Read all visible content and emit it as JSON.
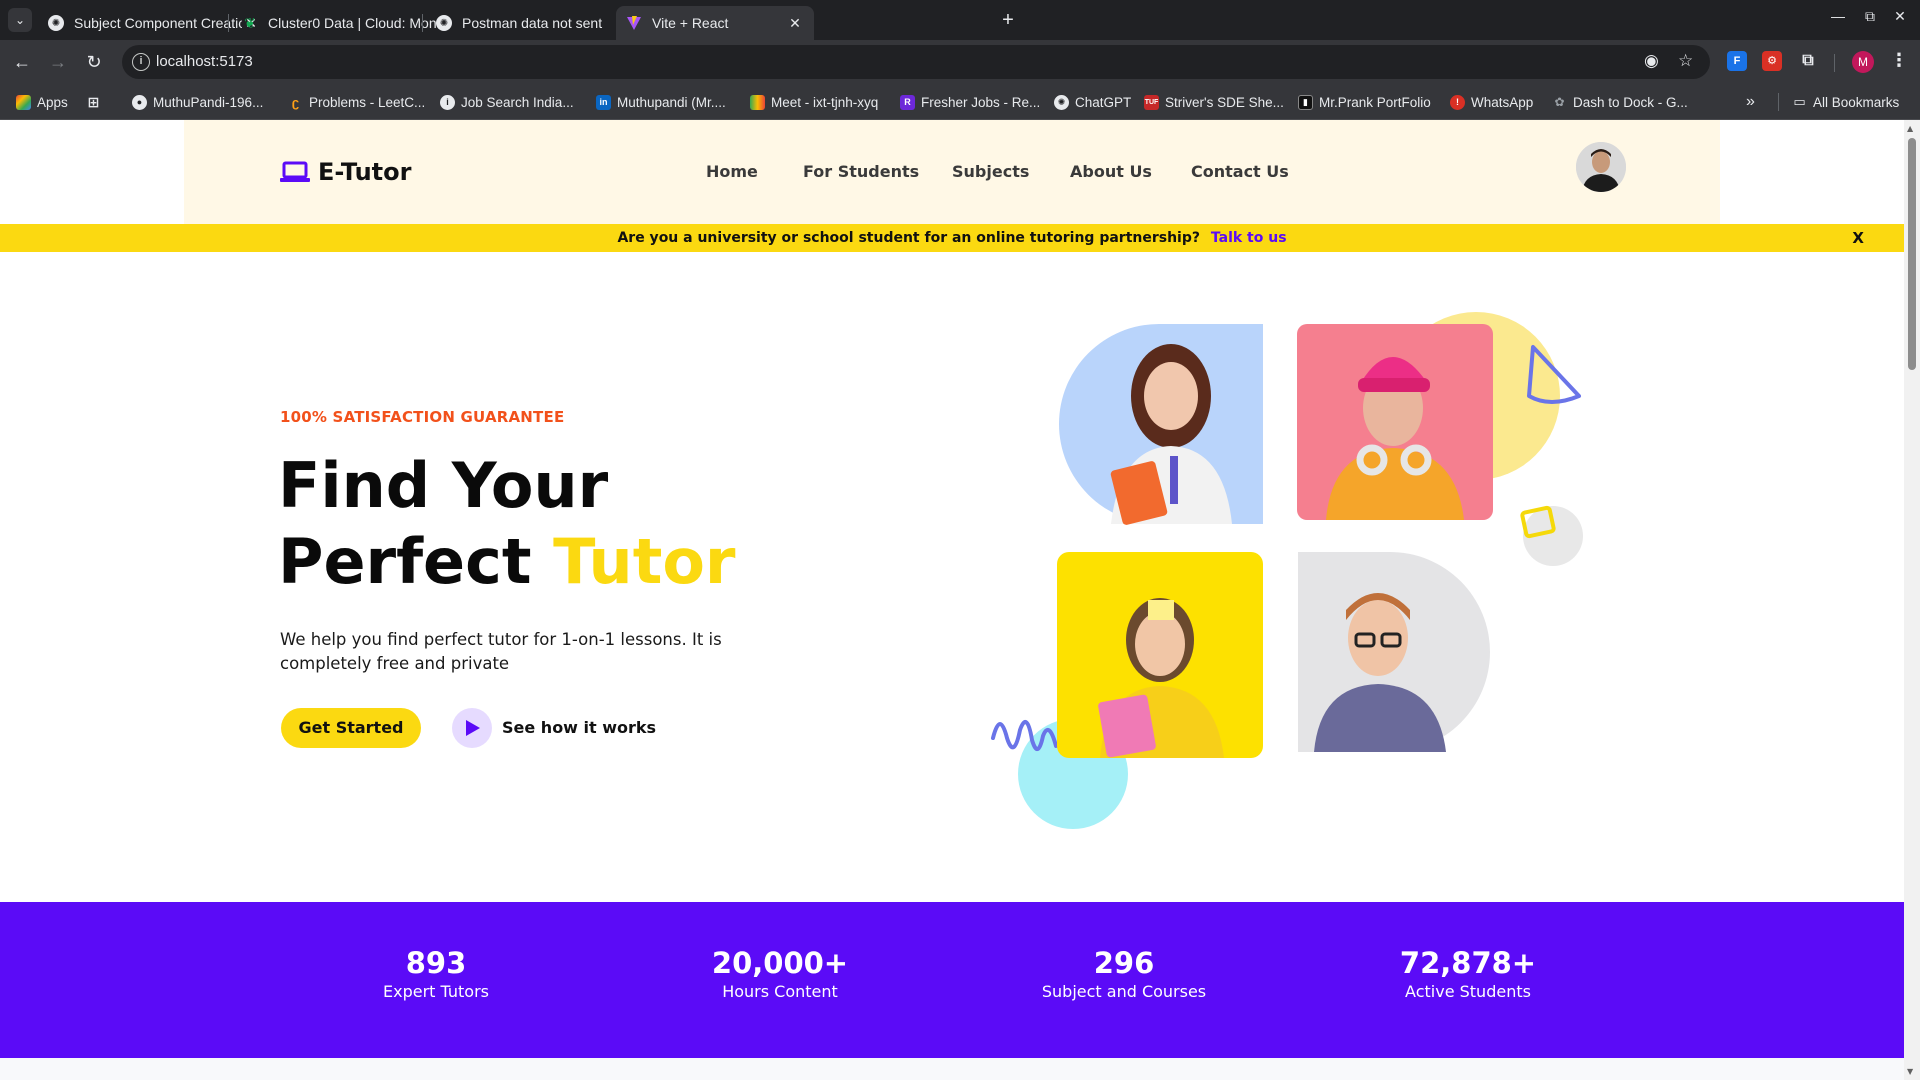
{
  "browser": {
    "tabs": [
      {
        "title": "Subject Component Creatio",
        "favicon": "openai-icon"
      },
      {
        "title": "Cluster0 Data | Cloud: Mon",
        "favicon": "mongodb-leaf-icon"
      },
      {
        "title": "Postman data not sent",
        "favicon": "openai-icon"
      },
      {
        "title": "Vite + React",
        "favicon": "vite-icon",
        "active": true
      }
    ],
    "url": "localhost:5173",
    "profile_initial": "M",
    "bookmarks": [
      {
        "label": "Apps",
        "icon": "apps-grid-icon"
      },
      {
        "label": "",
        "icon": "tab-groups-icon"
      },
      {
        "label": "MuthuPandi-196...",
        "icon": "github-icon"
      },
      {
        "label": "Problems - LeetC...",
        "icon": "leetcode-icon"
      },
      {
        "label": "Job Search India...",
        "icon": "info-icon"
      },
      {
        "label": "Muthupandi (Mr....",
        "icon": "linkedin-icon"
      },
      {
        "label": "Meet - ixt-tjnh-xyq",
        "icon": "google-meet-icon"
      },
      {
        "label": "Fresher Jobs - Re...",
        "icon": "fresher-jobs-icon"
      },
      {
        "label": "ChatGPT",
        "icon": "openai-icon"
      },
      {
        "label": "Striver's SDE She...",
        "icon": "tuf-icon"
      },
      {
        "label": "Mr.Prank PortFolio",
        "icon": "portfolio-icon"
      },
      {
        "label": "WhatsApp",
        "icon": "whatsapp-icon"
      },
      {
        "label": "Dash to Dock - G...",
        "icon": "gnome-icon"
      }
    ],
    "all_bookmarks": "All Bookmarks"
  },
  "site": {
    "logo": "E-Tutor",
    "nav": [
      "Home",
      "For Students",
      "Subjects",
      "About Us",
      "Contact Us"
    ],
    "banner": {
      "text": "Are you a university or school student for an online tutoring partnership?",
      "link": "Talk to us",
      "close": "X"
    },
    "hero": {
      "eyebrow": "100% SATISFACTION GUARANTEE",
      "title_line1": "Find Your",
      "title_line2_a": "Perfect ",
      "title_line2_b": "Tutor",
      "description": "We help you find perfect tutor for 1-on-1 lessons. It is completely free and private",
      "cta": "Get Started",
      "secondary": "See how it works"
    },
    "stats": [
      {
        "value": "893",
        "label": "Expert Tutors"
      },
      {
        "value": "20,000+",
        "label": "Hours Content"
      },
      {
        "value": "296",
        "label": "Subject and Courses"
      },
      {
        "value": "72,878+",
        "label": "Active Students"
      }
    ]
  },
  "colors": {
    "accent_yellow": "#fbd911",
    "brand_purple": "#5b0bf7",
    "eyebrow_orange": "#f2511b",
    "header_bg": "#fff8e6"
  }
}
